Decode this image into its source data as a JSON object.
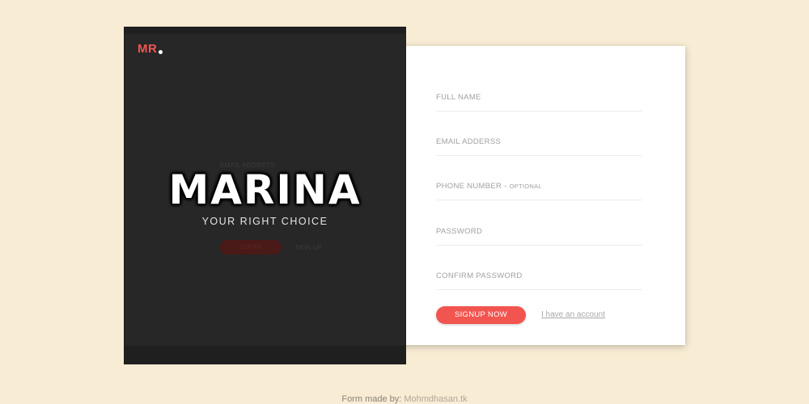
{
  "brand": {
    "logo": "MR",
    "title": "MARINA",
    "tagline": "YOUR RIGHT CHOICE"
  },
  "ghost_login": {
    "email_label": "EMAIL ADDRESS",
    "login_label": "LOGIN",
    "signup_label": "SIGN UP"
  },
  "signup_form": {
    "fields": [
      {
        "label": "FULL NAME",
        "note": ""
      },
      {
        "label": "EMAIL ADDERSS",
        "note": ""
      },
      {
        "label": "PHONE NUMBER - ",
        "note": "OPTIONAL"
      },
      {
        "label": "PASSWORD",
        "note": ""
      },
      {
        "label": "CONFIRM PASSWORD",
        "note": ""
      }
    ],
    "submit_label": "SIGNUP NOW",
    "account_link": "I have an account"
  },
  "footer": {
    "prefix": "Form made by: ",
    "site": "Mohmdhasan.tk"
  },
  "colors": {
    "background": "#f8ecd4",
    "accent": "#f2554f",
    "panel": "#272727",
    "card": "#ffffff"
  }
}
